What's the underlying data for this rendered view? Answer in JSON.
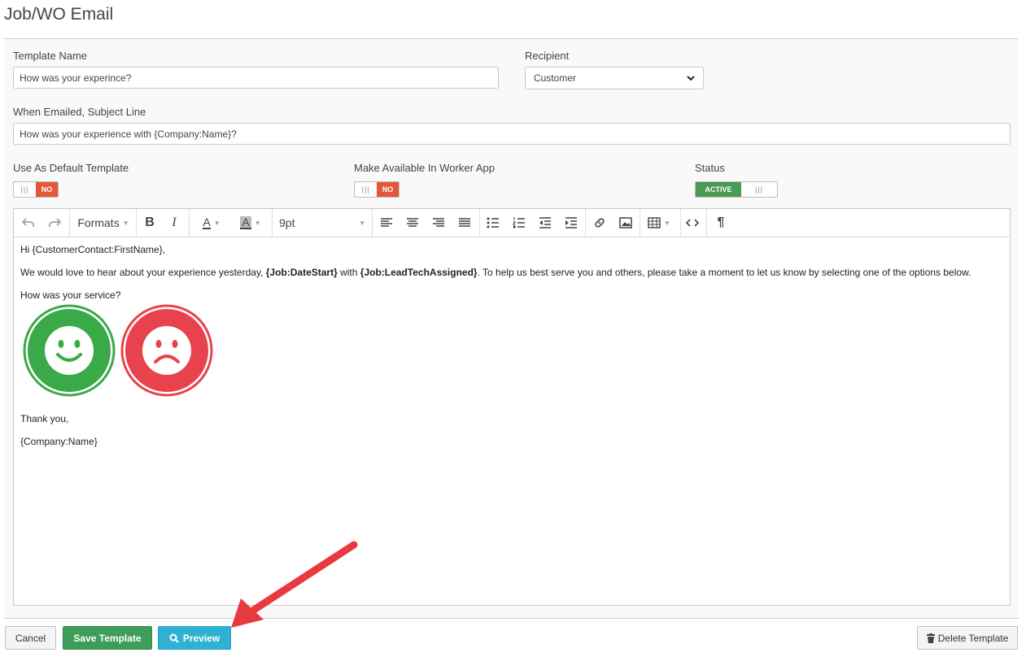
{
  "page": {
    "title": "Job/WO Email"
  },
  "form": {
    "template_name": {
      "label": "Template Name",
      "value": "How was your experince?"
    },
    "recipient": {
      "label": "Recipient",
      "selected": "Customer"
    },
    "subject": {
      "label": "When Emailed, Subject Line",
      "value": "How was your experience with {Company:Name}?"
    },
    "default_template": {
      "label": "Use As Default Template",
      "state": "NO"
    },
    "worker_app": {
      "label": "Make Available In Worker App",
      "state": "NO"
    },
    "status": {
      "label": "Status",
      "state": "ACTIVE"
    }
  },
  "toolbar": {
    "formats_label": "Formats",
    "font_size": "9pt",
    "icons": [
      "undo-icon",
      "redo-icon",
      "bold-icon",
      "italic-icon",
      "text-color-icon",
      "background-color-icon",
      "align-left-icon",
      "align-center-icon",
      "align-right-icon",
      "justify-icon",
      "bullet-list-icon",
      "numbered-list-icon",
      "outdent-icon",
      "indent-icon",
      "link-icon",
      "image-icon",
      "table-icon",
      "source-code-icon",
      "paragraph-icon"
    ]
  },
  "content": {
    "greeting": "Hi {CustomerContact:FirstName},",
    "line2_part1": "We would love to hear about your experience yesterday, ",
    "line2_bold1": "{Job:DateStart}",
    "line2_part2": " with ",
    "line2_bold2": "{Job:LeadTechAssigned}",
    "line2_part3": ". To help us best serve you and others, please take a moment to let us know by selecting one of the options below.",
    "question": "How was your service?",
    "thanks": "Thank you,",
    "signature": "{Company:Name}"
  },
  "buttons": {
    "cancel": "Cancel",
    "save": "Save Template",
    "preview": "Preview",
    "delete": "Delete Template"
  },
  "colors": {
    "happy": "#3aaa48",
    "sad": "#e8434c",
    "no": "#e4553b",
    "active": "#4a9a53",
    "annotation_arrow": "#e8393f"
  }
}
